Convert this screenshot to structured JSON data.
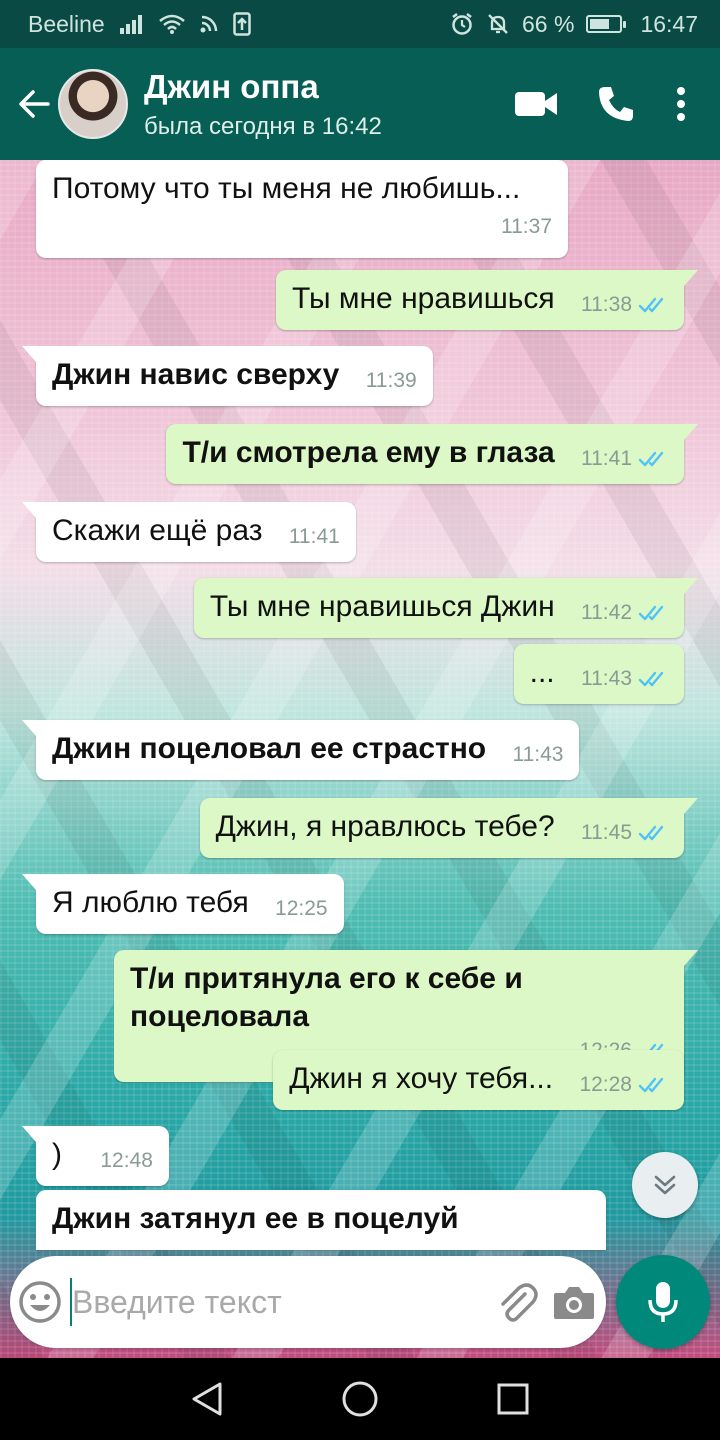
{
  "status_bar": {
    "carrier": "Beeline",
    "battery_percent": "66 %",
    "battery_level": 0.66,
    "time": "16:47",
    "icons": [
      "signal-icon",
      "wifi-icon",
      "nfc-icon",
      "upload-icon",
      "alarm-icon",
      "mute-icon",
      "battery-icon"
    ]
  },
  "header": {
    "contact_name": "Джин оппа",
    "last_seen": "была сегодня в 16:42",
    "icons": [
      "back-arrow-icon",
      "avatar",
      "video-call-icon",
      "phone-call-icon",
      "more-vert-icon"
    ]
  },
  "messages": [
    {
      "dir": "in",
      "text": "Потому что ты меня не любишь...",
      "time": "11:37",
      "bold": false
    },
    {
      "dir": "out",
      "text": "Ты мне нравишься",
      "time": "11:38",
      "bold": false,
      "read": true
    },
    {
      "dir": "in",
      "text": "Джин навис сверху",
      "time": "11:39",
      "bold": true
    },
    {
      "dir": "out",
      "text": "Т/и смотрела ему в глаза",
      "time": "11:41",
      "bold": true,
      "read": true
    },
    {
      "dir": "in",
      "text": "Скажи ещё раз",
      "time": "11:41",
      "bold": false
    },
    {
      "dir": "out",
      "text": "Ты мне нравишься Джин",
      "time": "11:42",
      "bold": false,
      "read": true
    },
    {
      "dir": "out",
      "text": "...",
      "time": "11:43",
      "bold": false,
      "read": true
    },
    {
      "dir": "in",
      "text": "Джин поцеловал ее страстно",
      "time": "11:43",
      "bold": true
    },
    {
      "dir": "out",
      "text": "Джин, я нравлюсь тебе?",
      "time": "11:45",
      "bold": false,
      "read": true
    },
    {
      "dir": "in",
      "text": "Я люблю тебя",
      "time": "12:25",
      "bold": false
    },
    {
      "dir": "out",
      "text": "Т/и притянула его к себе и поцеловала",
      "time": "12:26",
      "bold": true,
      "read": true
    },
    {
      "dir": "out",
      "text": "Джин я хочу тебя...",
      "time": "12:28",
      "bold": false,
      "read": true
    },
    {
      "dir": "in",
      "text": ")",
      "time": "12:48",
      "bold": false
    },
    {
      "dir": "in",
      "text": "Джин затянул ее в поцелуй",
      "time": "",
      "bold": true
    }
  ],
  "composer": {
    "placeholder": "Введите текст",
    "value": ""
  },
  "colors": {
    "header": "#075e54",
    "status_bar": "#0a4a44",
    "outgoing_bubble": "#dcf8c6",
    "incoming_bubble": "#ffffff",
    "read_ticks": "#4fc3f7",
    "mic_button": "#00897b"
  }
}
